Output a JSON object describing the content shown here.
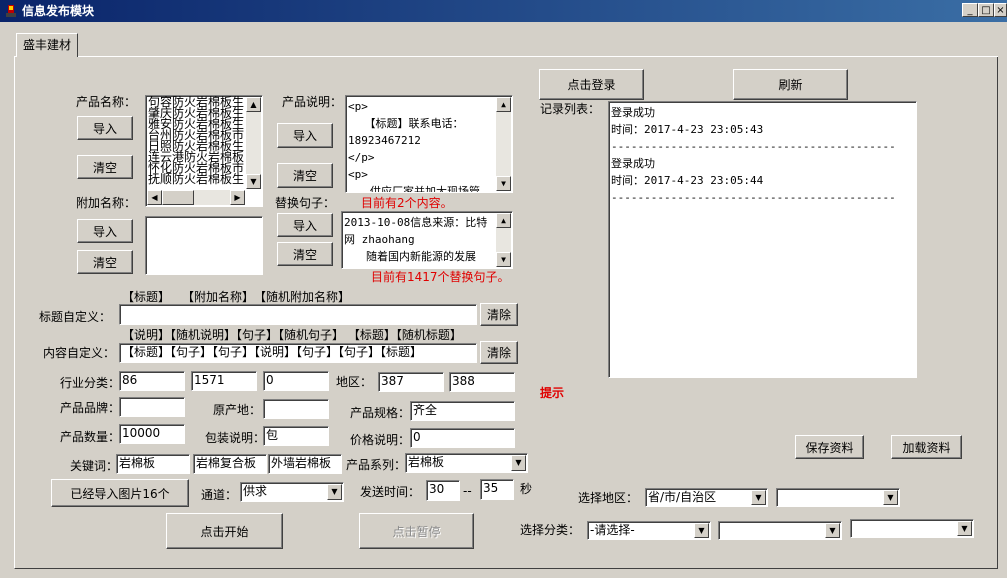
{
  "window": {
    "title": "信息发布模块",
    "min": "0",
    "max": "1",
    "close": "r"
  },
  "tab": {
    "label": "盛丰建材"
  },
  "product_name": {
    "label": "产品名称：",
    "import": "导入",
    "clear": "清空",
    "items": [
      "句容防火岩棉板生",
      "肇庆防火岩棉板生",
      "雅安防火岩棉板生",
      "台州防火岩棉板市",
      "日照防火岩棉板生",
      "连云港防火岩棉板",
      "怀化防火岩棉板市",
      "抚顺防火岩棉板生"
    ]
  },
  "product_desc": {
    "label": "产品说明：",
    "import": "导入",
    "clear": "清空",
    "lines": [
      "<p>",
      "　　【标题】联系电话：",
      "18923467212",
      "</p>",
      "<p>",
      "　　供应厂家并加大现场管"
    ],
    "count_note": "目前有2个内容。"
  },
  "extra_name": {
    "label": "附加名称：",
    "import": "导入",
    "clear": "清空"
  },
  "replace": {
    "label": "替换句子：",
    "import": "导入",
    "clear": "清空",
    "lines": [
      "",
      "2013-10-08信息来源：比特",
      "网 zhaohang",
      "　　随着国内新能源的发展"
    ],
    "count_note": "目前有1417个替换句子。"
  },
  "title_custom": {
    "tags": "【标题】　　【附加名称】　【随机附加名称】",
    "label": "标题自定义：",
    "value": "",
    "clear": "清除"
  },
  "content_custom": {
    "tags": "【说明】【随机说明】【句子】【随机句子】 【标题】【随机标题】",
    "label": "内容自定义：",
    "value": "【标题】【句子】【句子】【说明】【句子】【句子】【标题】",
    "clear": "清除"
  },
  "fields": {
    "industry_label": "行业分类：",
    "industry": [
      "86",
      "1571",
      "0"
    ],
    "region_label": "地区：",
    "region": [
      "387",
      "388"
    ],
    "hint": "提示",
    "brand_label": "产品品牌：",
    "brand": "",
    "origin_label": "原产地：",
    "origin": "",
    "spec_label": "产品规格：",
    "spec": "齐全",
    "qty_label": "产品数量：",
    "qty": "10000",
    "pack_label": "包装说明：",
    "pack": "包",
    "price_label": "价格说明：",
    "price": "0",
    "kw_label": "关键词：",
    "kw": [
      "岩棉板",
      "岩棉复合板",
      "外墙岩棉板"
    ],
    "series_label": "产品系列：",
    "series": "岩棉板"
  },
  "bottom": {
    "images_btn": "已经导入图片16个",
    "channel_label": "通道：",
    "channel": "供求",
    "send_label": "发送时间：",
    "send_from": "30",
    "dash": "--",
    "send_to": "35",
    "sec": "秒",
    "start": "点击开始",
    "pause": "点击暂停"
  },
  "right": {
    "login": "点击登录",
    "refresh": "刷新",
    "records_label": "记录列表：",
    "records": [
      "登录成功",
      "时间：2017-4-23 23:05:43",
      "-------------------------------------------",
      "登录成功",
      "时间：2017-4-23 23:05:44",
      "-------------------------------------------"
    ],
    "save": "保存资料",
    "load": "加载资料",
    "area_label": "选择地区：",
    "area": [
      "省/市/自治区",
      ""
    ],
    "cat_label": "选择分类：",
    "cat": [
      "-请选择-",
      "",
      ""
    ]
  }
}
